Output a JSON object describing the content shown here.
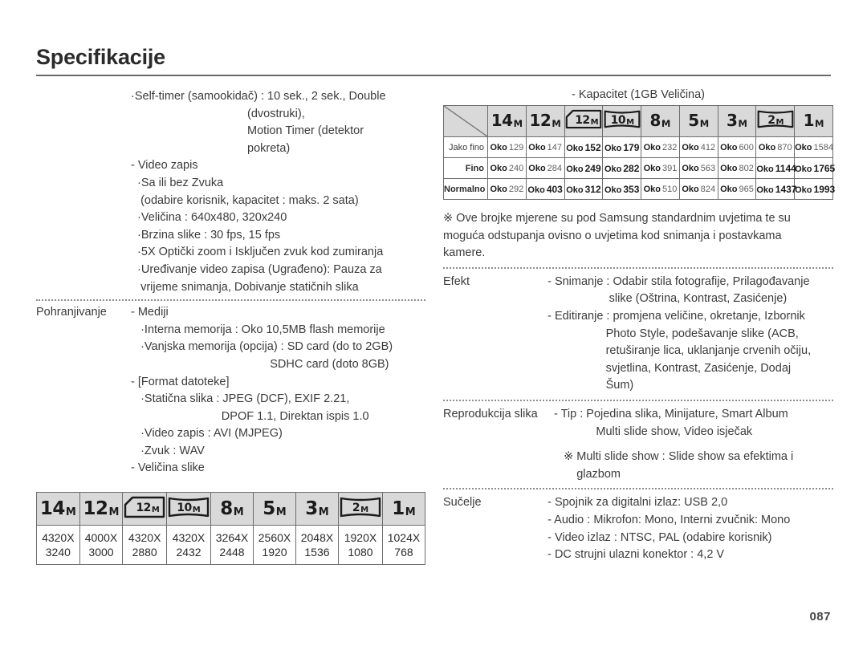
{
  "page": {
    "title": "Specifikacije",
    "number": "087"
  },
  "left": {
    "block_selftimer": {
      "lines": [
        "·Self-timer (samookidač) : 10 sek., 2 sek., Double",
        "                                    (dvostruki),",
        "                                    Motion Timer (detektor",
        "                                    pokreta)"
      ]
    },
    "block_video": {
      "lines": [
        "- Video zapis",
        "  ·Sa ili bez Zvuka",
        "   (odabire korisnik, kapacitet : maks. 2 sata)",
        "  ·Veličina : 640x480, 320x240",
        "  ·Brzina slike : 30 fps, 15 fps",
        "  ·5X Optički zoom i Isključen zvuk kod zumiranja",
        "  ·Uređivanje video zapisa (Ugrađeno): Pauza za",
        "   vrijeme snimanja, Dobivanje statičnih slika"
      ]
    },
    "row_storage": {
      "label": "Pohranjivanje",
      "lines": [
        "- Mediji",
        "   ·Interna memorija : Oko 10,5MB flash memorije",
        "   ·Vanjska memorija (opcija) : SD card (do to 2GB)",
        "                                           SDHC card (doto 8GB)",
        "- [Format datoteke]",
        "   ·Statična slika : JPEG (DCF), EXIF 2.21,",
        "                            DPOF 1.1, Direktan ispis 1.0",
        "   ·Video zapis : AVI (MJPEG)",
        "   ·Zvuk : WAV",
        "- Veličina slike"
      ]
    },
    "image_size_table": {
      "headers": [
        {
          "kind": "plain",
          "big": "14",
          "sm": "M"
        },
        {
          "kind": "plain",
          "big": "12",
          "sm": "M"
        },
        {
          "kind": "fold",
          "big": "12",
          "sm": "M"
        },
        {
          "kind": "pano",
          "big": "10",
          "sm": "M"
        },
        {
          "kind": "plain",
          "big": "8",
          "sm": "M"
        },
        {
          "kind": "plain",
          "big": "5",
          "sm": "M"
        },
        {
          "kind": "plain",
          "big": "3",
          "sm": "M"
        },
        {
          "kind": "pano",
          "big": "2",
          "sm": "M"
        },
        {
          "kind": "plain",
          "big": "1",
          "sm": "M"
        }
      ],
      "values": [
        [
          "4320X",
          "3240"
        ],
        [
          "4000X",
          "3000"
        ],
        [
          "4320X",
          "2880"
        ],
        [
          "4320X",
          "2432"
        ],
        [
          "3264X",
          "2448"
        ],
        [
          "2560X",
          "1920"
        ],
        [
          "2048X",
          "1536"
        ],
        [
          "1920X",
          "1080"
        ],
        [
          "1024X",
          "768"
        ]
      ]
    }
  },
  "right": {
    "capacity": {
      "title": "- Kapacitet (1GB Veličina)",
      "headers": [
        {
          "kind": "plain",
          "big": "14",
          "sm": "M"
        },
        {
          "kind": "plain",
          "big": "12",
          "sm": "M"
        },
        {
          "kind": "fold",
          "big": "12",
          "sm": "M"
        },
        {
          "kind": "pano",
          "big": "10",
          "sm": "M"
        },
        {
          "kind": "plain",
          "big": "8",
          "sm": "M"
        },
        {
          "kind": "plain",
          "big": "5",
          "sm": "M"
        },
        {
          "kind": "plain",
          "big": "3",
          "sm": "M"
        },
        {
          "kind": "pano",
          "big": "2",
          "sm": "M"
        },
        {
          "kind": "plain",
          "big": "1",
          "sm": "M"
        }
      ],
      "prefix": "Oko",
      "rows": [
        {
          "label": "Jako fino",
          "label_style": "light",
          "values": [
            "129",
            "147",
            "152",
            "179",
            "232",
            "412",
            "600",
            "870",
            "1584"
          ],
          "strong": [
            false,
            false,
            true,
            true,
            false,
            false,
            false,
            false,
            false
          ]
        },
        {
          "label": "Fino",
          "label_style": "bold",
          "values": [
            "240",
            "284",
            "249",
            "282",
            "391",
            "563",
            "802",
            "1144",
            "1765"
          ],
          "strong": [
            false,
            false,
            true,
            true,
            false,
            false,
            false,
            true,
            true
          ]
        },
        {
          "label": "Normalno",
          "label_style": "bold",
          "values": [
            "292",
            "403",
            "312",
            "353",
            "510",
            "824",
            "965",
            "1437",
            "1993"
          ],
          "strong": [
            false,
            true,
            true,
            true,
            false,
            false,
            false,
            true,
            true
          ]
        }
      ]
    },
    "note_samsung": {
      "lines": [
        "※ Ove brojke mjerene su pod Samsung standardnim uvjetima te su",
        "moguća odstupanja ovisno o uvjetima kod snimanja i postavkama",
        "kamere."
      ]
    },
    "row_effect": {
      "label": "Efekt",
      "lines": [
        "   - Snimanje : Odabir stila fotografije, Prilagođavanje",
        "                      slike (Oštrina, Kontrast, Zasićenje)",
        "   - Editiranje : promjena veličine, okretanje, Izbornik",
        "                     Photo Style, podešavanje slike (ACB,",
        "                     retuširanje lica, uklanjanje crvenih očiju,",
        "                     svjetlina, Kontrast, Zasićenje, Dodaj",
        "                     Šum)"
      ]
    },
    "row_playback": {
      "label": "Reprodukcija slika",
      "lines": [
        "- Tip : Pojedina slika, Minijature, Smart Album",
        "             Multi slide show, Video isječak"
      ],
      "note": [
        "   ※ Multi slide show : Slide show sa efektima i",
        "       glazbom"
      ]
    },
    "row_interface": {
      "label": "Sučelje",
      "lines": [
        "   - Spojnik za digitalni izlaz: USB 2,0",
        "   - Audio : Mikrofon: Mono, Interni zvučnik: Mono",
        "   - Video izlaz : NTSC, PAL (odabire korisnik)",
        "   - DC strujni ulazni konektor : 4,2 V"
      ]
    }
  }
}
